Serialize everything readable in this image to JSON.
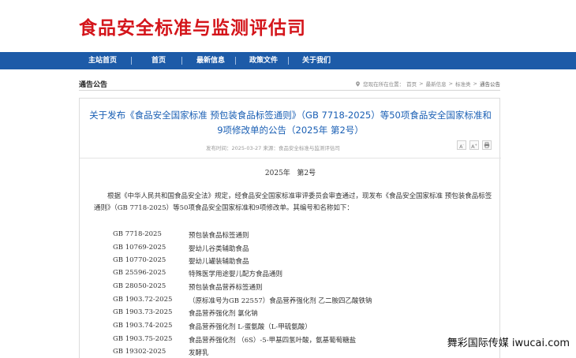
{
  "site": {
    "title": "食品安全标准与监测评估司"
  },
  "nav": {
    "items": [
      {
        "label": "主站首页"
      },
      {
        "label": "首页"
      },
      {
        "label": "最新信息"
      },
      {
        "label": "政策文件"
      },
      {
        "label": "关于我们"
      }
    ]
  },
  "section": {
    "title": "通告公告",
    "breadcrumb": {
      "prefix": "您现在所在位置：",
      "items": [
        "首页",
        "最新信息",
        "标准类",
        "通告公告"
      ]
    }
  },
  "article": {
    "title": "关于发布《食品安全国家标准 预包装食品标签通则》（GB 7718-2025）等50项食品安全国家标准和9项修改单的公告（2025年 第2号）",
    "meta": "发布时间：2025-03-27  来源：食品安全标准与监测评估司",
    "tools": {
      "small": "A",
      "large": "A",
      "print": "print"
    },
    "issue": "2025年   第2号",
    "intro": "根据《中华人民共和国食品安全法》规定，经食品安全国家标准审评委员会审查通过，现发布《食品安全国家标准 预包装食品标签通则》（GB 7718-2025）等50项食品安全国家标准和9项修改单。其编号和名称如下：",
    "standards": [
      {
        "code": "GB 7718-2025",
        "name": "预包装食品标签通则"
      },
      {
        "code": "GB 10769-2025",
        "name": "婴幼儿谷类辅助食品"
      },
      {
        "code": "GB 10770-2025",
        "name": "婴幼儿罐装辅助食品"
      },
      {
        "code": "GB 25596-2025",
        "name": "特殊医学用途婴儿配方食品通则"
      },
      {
        "code": "GB 28050-2025",
        "name": "预包装食品营养标签通则"
      },
      {
        "code": "GB 1903.72-2025",
        "name": "（原标准号为GB 22557）食品营养强化剂 乙二胺四乙酸铁钠"
      },
      {
        "code": "GB 1903.73-2025",
        "name": "食品营养强化剂 氯化钠"
      },
      {
        "code": "GB 1903.74-2025",
        "name": "食品营养强化剂 L-蛋氨酸（L-甲硫氨酸）"
      },
      {
        "code": "GB 1903.75-2025",
        "name": "食品营养强化剂 （6S）-5-甲基四氢叶酸，氨基葡萄糖盐"
      },
      {
        "code": "GB 19302-2025",
        "name": "发酵乳"
      }
    ]
  },
  "watermark": "舞彩国际传媒 iwucai.com",
  "colors": {
    "brand_red": "#d4151b",
    "nav_blue": "#1d5ba8",
    "title_blue": "#1a5fb4"
  }
}
